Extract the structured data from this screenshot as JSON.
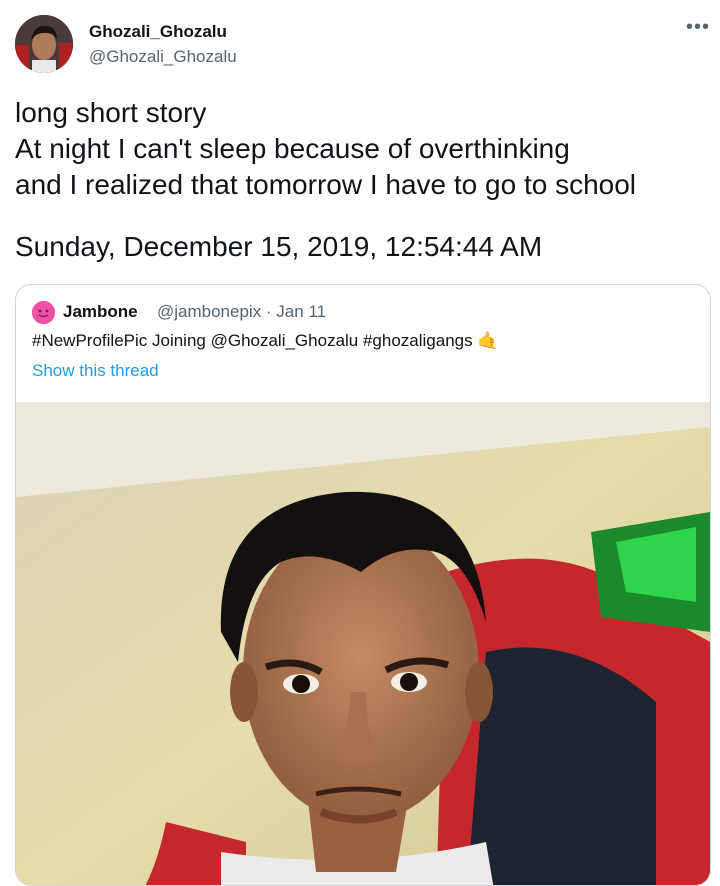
{
  "tweet": {
    "author": {
      "name": "Ghozali_Ghozalu",
      "handle": "@Ghozali_Ghozalu"
    },
    "more_icon": "more-icon",
    "text_lines": [
      "long short story",
      "At night I can't sleep because of overthinking",
      "and I realized that tomorrow I have to go to school"
    ],
    "timestamp": "Sunday, December 15, 2019, 12:54:44 AM"
  },
  "quoted": {
    "author": {
      "name": "Jambone",
      "meta": "@jambonepix · Jan 11"
    },
    "text": "#NewProfilePic Joining @Ghozali_Ghozalu #ghozaligangs",
    "emoji": "🤙",
    "link_label": "Show this thread",
    "photo_icon": "selfie-photo"
  },
  "colors": {
    "text": "#0f1419",
    "secondary": "#536471",
    "link": "#1d9bf0",
    "border": "#cfd9de"
  }
}
